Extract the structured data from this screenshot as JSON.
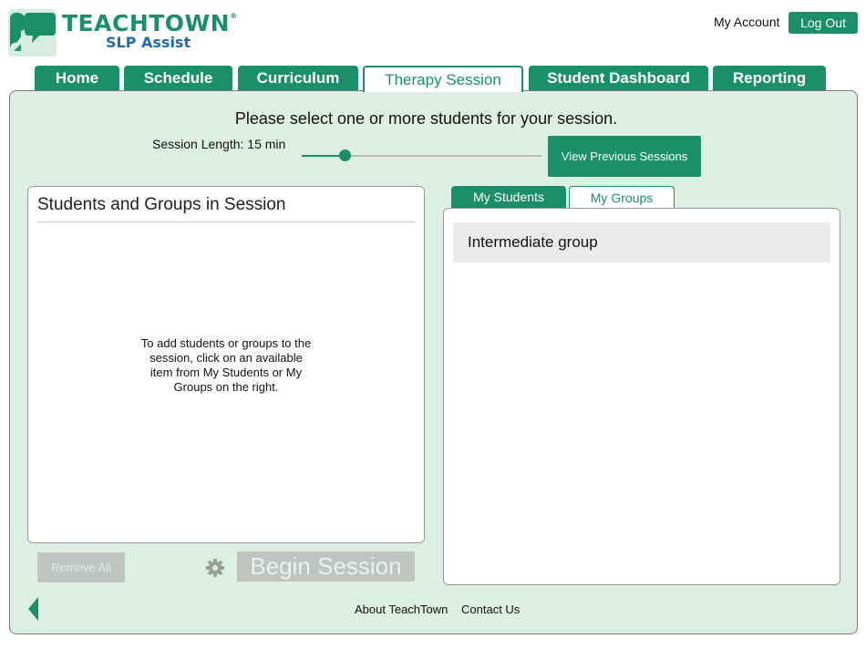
{
  "header": {
    "brand_title": "TEACHTOWN",
    "brand_mark": "®",
    "brand_subtitle": "SLP Assist",
    "account_label": "My Account",
    "logout_label": "Log Out",
    "logo_icon": "speech-heads-icon",
    "accent_color": "#1a8f6a",
    "subtitle_color": "#1e6cb3"
  },
  "tabs": [
    {
      "label": "Home",
      "active": false
    },
    {
      "label": "Schedule",
      "active": false
    },
    {
      "label": "Curriculum",
      "active": false
    },
    {
      "label": "Therapy Session",
      "active": true
    },
    {
      "label": "Student Dashboard",
      "active": false
    },
    {
      "label": "Reporting",
      "active": false
    }
  ],
  "main": {
    "instruction": "Please select one or more students for your session.",
    "session_length_label": "Session Length: 15 min",
    "session_length_fraction": 0.18,
    "view_previous_label": "View Previous Sessions",
    "session_panel": {
      "title": "Students and Groups in Session",
      "empty_message": "To add students or groups to the session, click on an available item from My Students or My Groups on the right."
    },
    "remove_all_label": "Remove All",
    "settings_icon": "gear-icon",
    "begin_session_label": "Begin Session",
    "subtabs": [
      {
        "label": "My Students",
        "active": true
      },
      {
        "label": "My Groups",
        "active": false
      }
    ],
    "list_items": [
      {
        "label": "Intermediate group"
      }
    ],
    "background_color": "#dcefe2",
    "disabled_color": "#bfc4c1"
  },
  "footer": {
    "back_icon": "back-arrow-icon",
    "about_label": "About TeachTown",
    "contact_label": "Contact Us"
  }
}
